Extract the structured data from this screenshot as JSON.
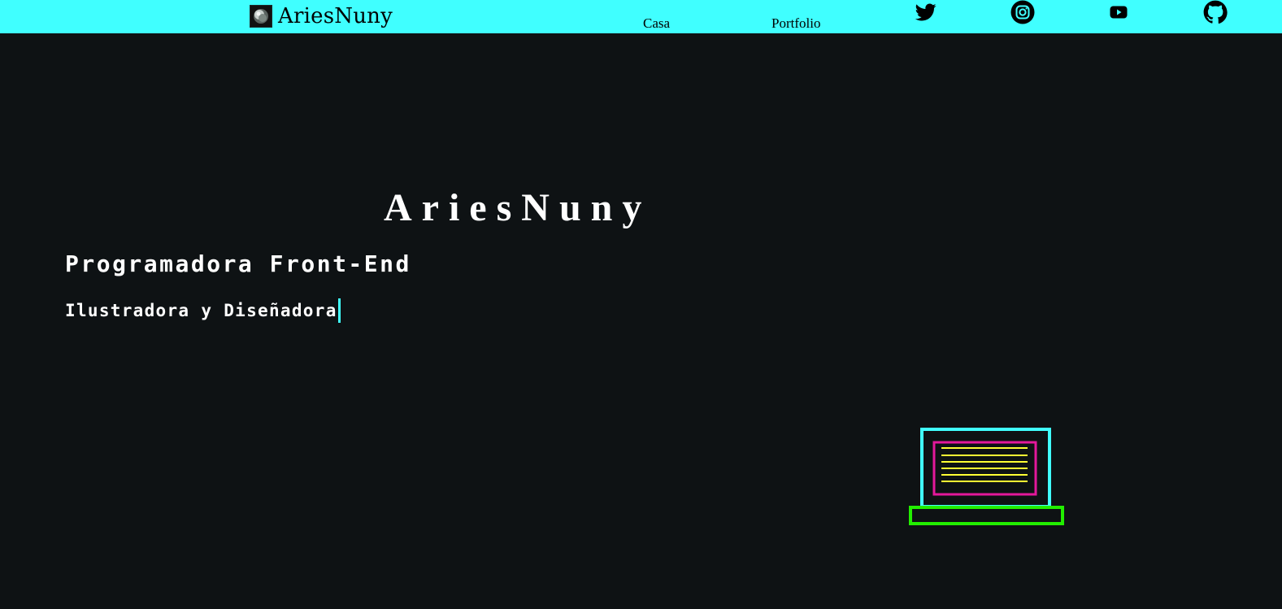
{
  "nav": {
    "brand": "AriesNuny",
    "links": [
      "Casa",
      "Portfolio"
    ],
    "social": [
      "twitter-icon",
      "instagram-icon",
      "youtube-icon",
      "github-icon"
    ]
  },
  "hero": {
    "title": "AriesNuny",
    "subtitle": "Programadora Front-End",
    "typed": "Ilustradora y Diseñadora"
  },
  "colors": {
    "navbar": "#40ffff",
    "background": "#0e1214",
    "laptop_frame": "#40ffff",
    "laptop_screen": "#e4189b",
    "laptop_lines": "#ffff33",
    "laptop_base": "#22ee00"
  }
}
